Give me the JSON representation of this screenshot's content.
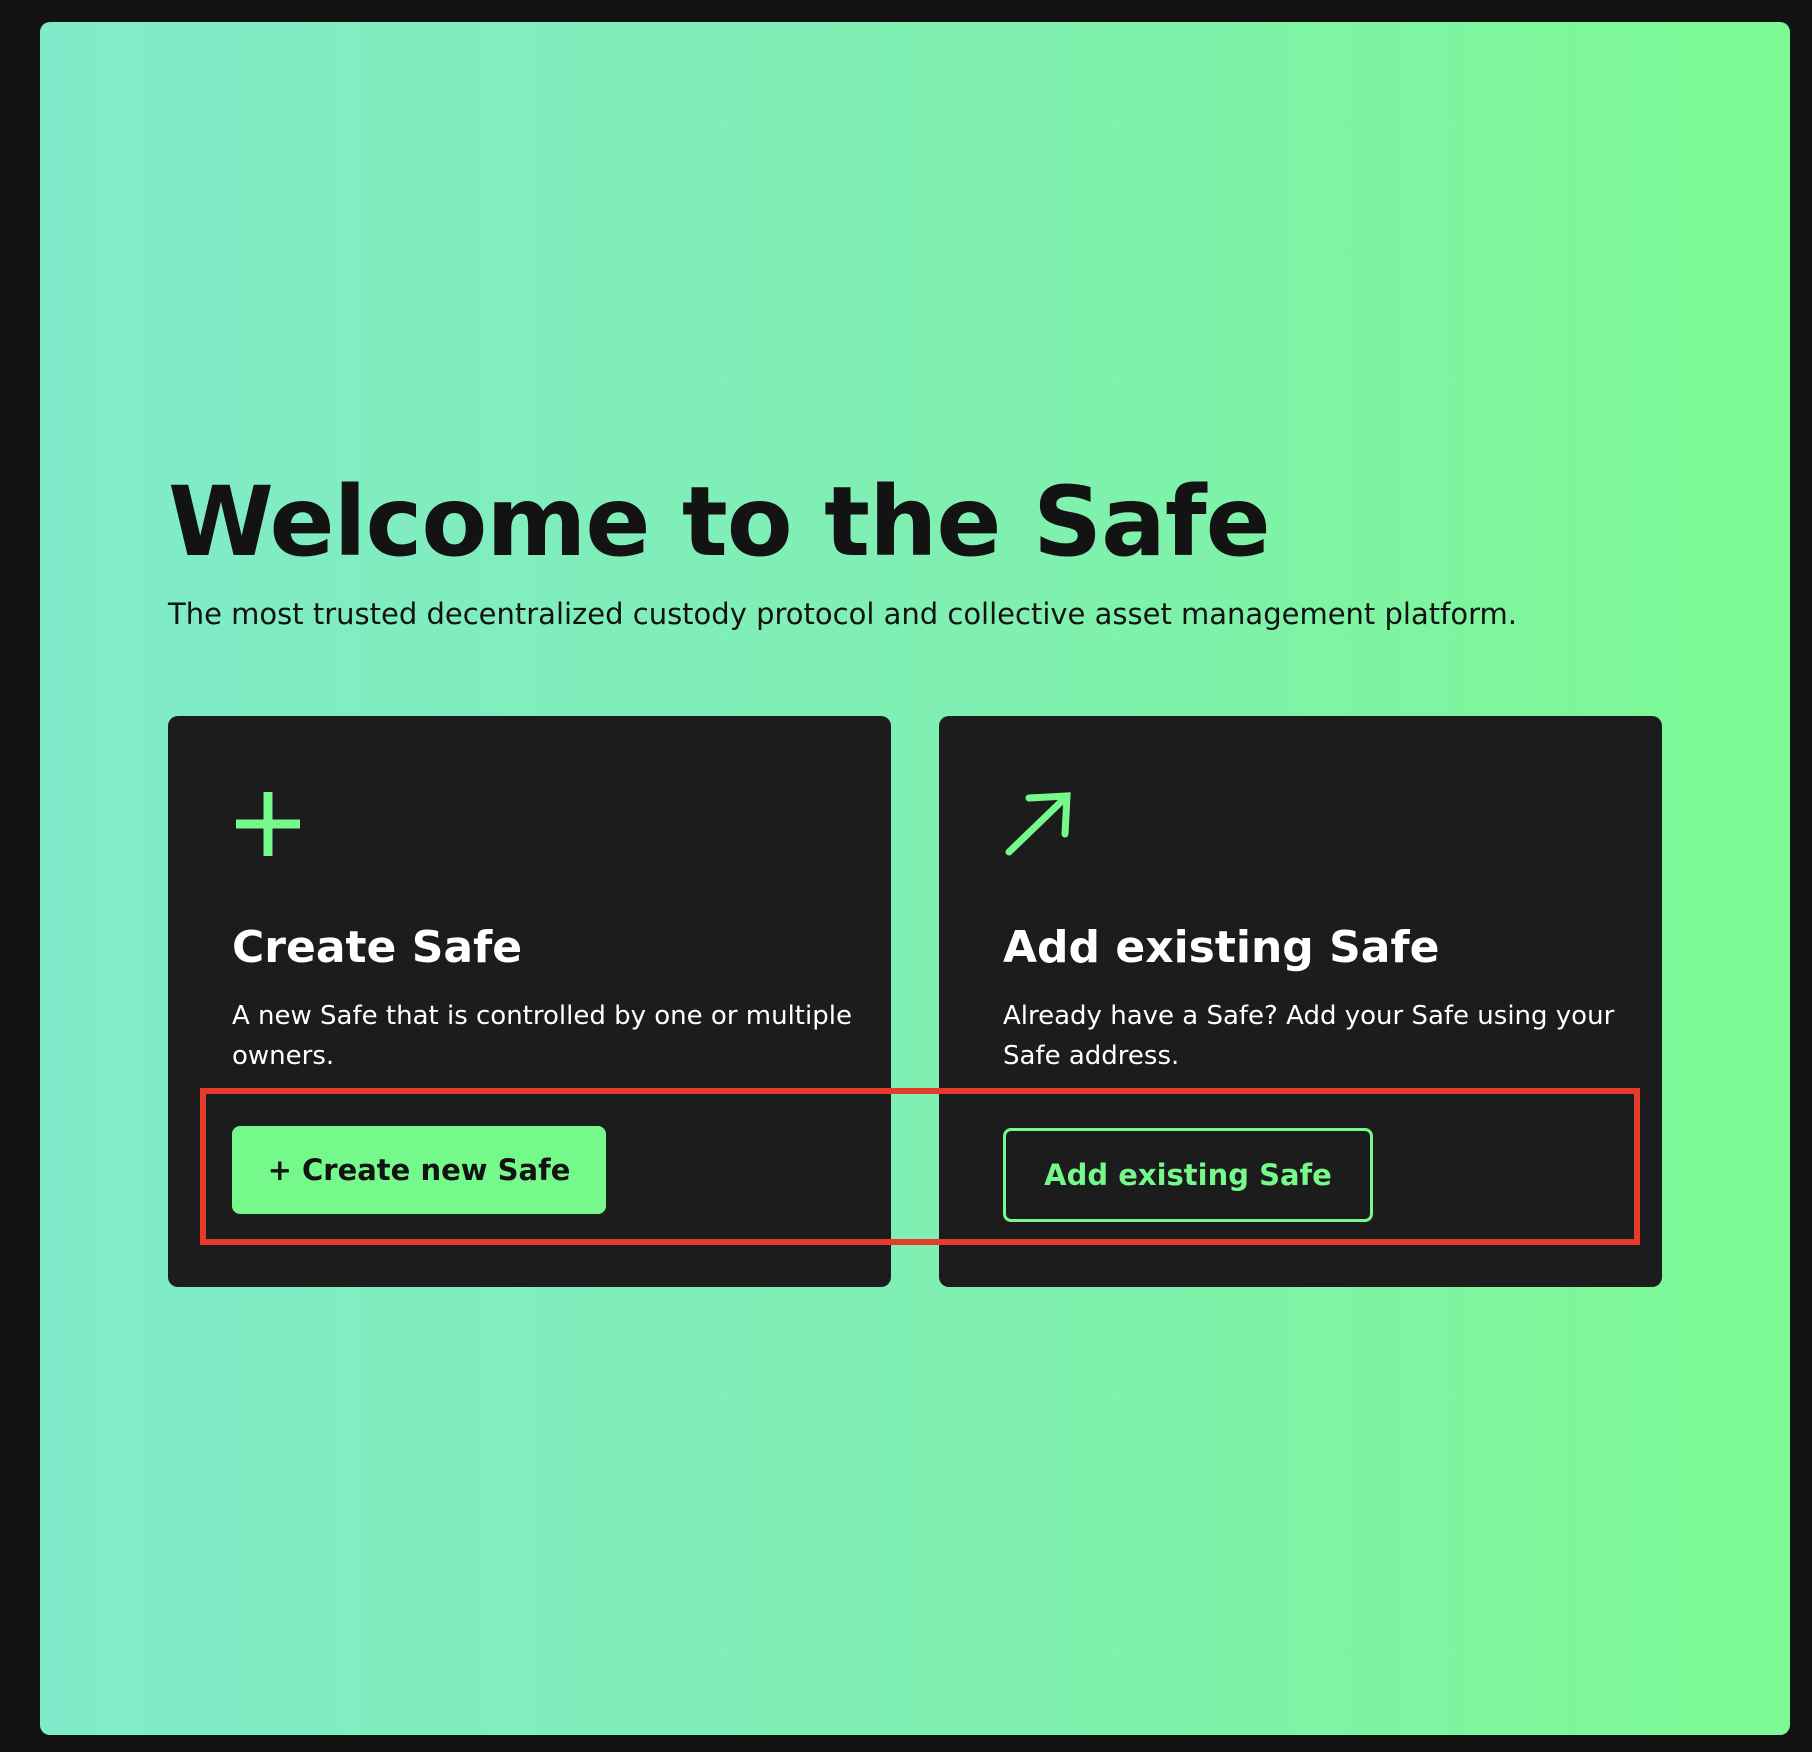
{
  "welcome": {
    "title": "Welcome to the Safe",
    "subtitle": "The most trusted decentralized custody protocol and collective asset management platform."
  },
  "cards": {
    "create": {
      "icon": "plus-icon",
      "title": "Create Safe",
      "description": "A new Safe that is controlled by one or multiple owners.",
      "button_label": "+ Create new Safe"
    },
    "add": {
      "icon": "arrow-up-right-icon",
      "title": "Add existing Safe",
      "description": "Already have a Safe? Add your Safe using your Safe address.",
      "button_label": "Add existing Safe"
    }
  },
  "colors": {
    "accent": "#76f98b",
    "card_background": "#1c1c1c",
    "highlight": "#e63b2b",
    "gradient_start": "#80ebca",
    "gradient_end": "#7cf993"
  }
}
